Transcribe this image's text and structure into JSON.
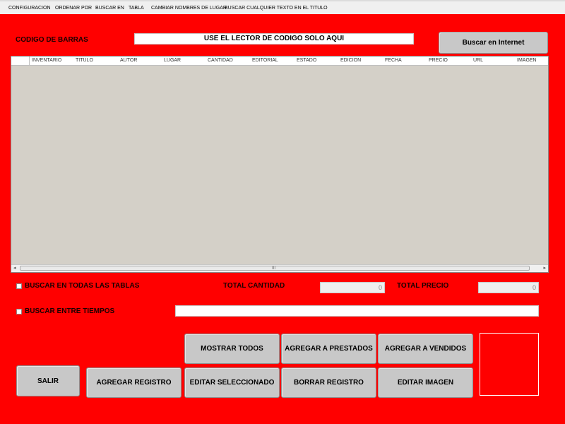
{
  "menu": [
    "CONFIGURACION",
    "ORDENAR POR",
    "BUSCAR EN",
    "TABLA",
    "CAMBIAR NOMBRES DE LUGAR",
    "BUSCAR CUALQUIER TEXTO EN EL TITULO"
  ],
  "barcode": {
    "label": "CODIGO DE BARRAS",
    "value": "USE EL LECTOR DE CODIGO SOLO AQUI"
  },
  "search_internet_label": "Buscar en Internet",
  "table": {
    "columns": [
      "INVENTARIO",
      "TITULO",
      "AUTOR",
      "LUGAR",
      "CANTIDAD",
      "EDITORIAL",
      "ESTADO",
      "EDICION",
      "FECHA",
      "PRECIO",
      "URL",
      "IMAGEN"
    ],
    "rows": [],
    "scroll_grip": "III"
  },
  "options": {
    "search_all_tables": "BUSCAR EN TODAS LAS TABLAS",
    "search_between_times": "BUSCAR ENTRE TIEMPOS"
  },
  "totals": {
    "cantidad_label": "TOTAL CANTIDAD",
    "cantidad_value": "0",
    "precio_label": "TOTAL PRECIO",
    "precio_value": "0"
  },
  "buttons": {
    "mostrar_todos": "MOSTRAR TODOS",
    "agregar_prestados": "AGREGAR A PRESTADOS",
    "agregar_vendidos": "AGREGAR A  VENDIDOS",
    "salir": "SALIR",
    "agregar_registro": "AGREGAR REGISTRO",
    "editar_seleccionado": "EDITAR SELECCIONADO",
    "borrar_registro": "BORRAR REGISTRO",
    "editar_imagen": "EDITAR IMAGEN"
  },
  "colors": {
    "background": "#ff0000",
    "button": "#c8c8c8",
    "table_body": "#d4d0c8"
  }
}
